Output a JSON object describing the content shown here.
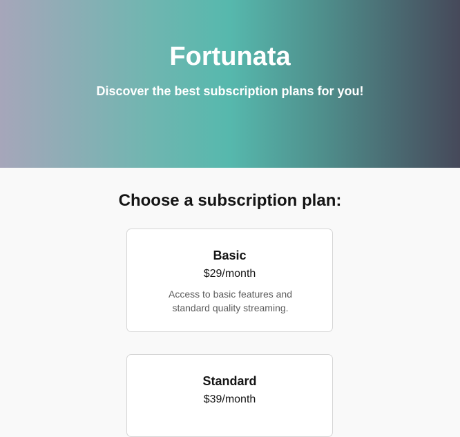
{
  "hero": {
    "title": "Fortunata",
    "subtitle": "Discover the best subscription plans for you!"
  },
  "main": {
    "heading": "Choose a subscription plan:",
    "plans": [
      {
        "name": "Basic",
        "price": "$29/month",
        "description": "Access to basic features and standard quality streaming."
      },
      {
        "name": "Standard",
        "price": "$39/month",
        "description": ""
      }
    ]
  },
  "colors": {
    "background": "#f9f9f9",
    "card_background": "#ffffff",
    "card_border": "#d6d6d6",
    "hero_gradient_start": "#a6a6ba",
    "hero_gradient_mid": "#56b8ad",
    "hero_gradient_end": "#46495a",
    "text_primary": "#141414",
    "text_secondary": "#5b5b5b"
  }
}
